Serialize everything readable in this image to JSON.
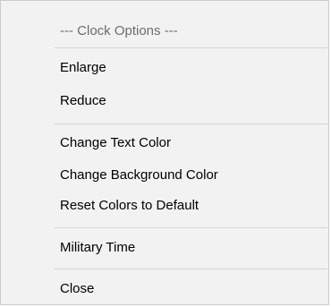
{
  "menu": {
    "header": "--- Clock Options ---",
    "items": [
      {
        "label": "Enlarge"
      },
      {
        "label": "Reduce"
      },
      {
        "label": "Change Text Color"
      },
      {
        "label": "Change Background Color"
      },
      {
        "label": "Reset Colors to Default"
      },
      {
        "label": "Military Time"
      },
      {
        "label": "Close"
      }
    ]
  }
}
